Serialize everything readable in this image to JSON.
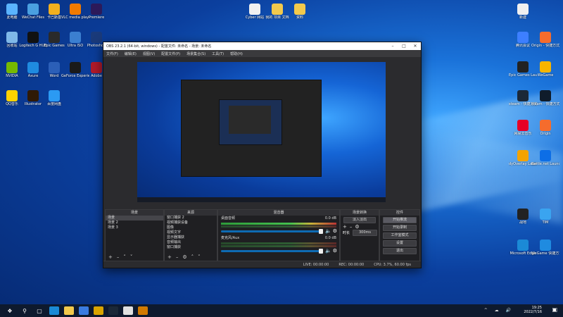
{
  "desktop": {
    "left_icons": [
      {
        "label": "此电脑",
        "color": "#5ab3ff"
      },
      {
        "label": "WeChat Files",
        "color": "#4aa0e0"
      },
      {
        "label": "卡巴斯基",
        "color": "#f2b01e"
      },
      {
        "label": "VLC media player",
        "color": "#f07a00"
      },
      {
        "label": "Premiere",
        "color": "#2c1a5a"
      },
      {
        "label": "回收站",
        "color": "#7fb8e8"
      },
      {
        "label": "Logitech G HUB",
        "color": "#111111"
      },
      {
        "label": "Epic Games",
        "color": "#2a2a2a"
      },
      {
        "label": "Ultra ISO",
        "color": "#3b7fd0"
      },
      {
        "label": "Photoshop",
        "color": "#1a3a7a"
      },
      {
        "label": "NVIDIA",
        "color": "#76b900"
      },
      {
        "label": "Axure",
        "color": "#1f8be0"
      },
      {
        "label": "Word",
        "color": "#2b5fb8"
      },
      {
        "label": "GeForce Experience",
        "color": "#1a1a1a"
      },
      {
        "label": "Adobe",
        "color": "#b01a2a"
      },
      {
        "label": "QQ音乐",
        "color": "#ffd200"
      },
      {
        "label": "Illustrator",
        "color": "#2f1a06"
      },
      {
        "label": "百度网盘",
        "color": "#2b9af3"
      }
    ],
    "right_icons": [
      {
        "label": "腾讯会议",
        "color": "#3d7fff"
      },
      {
        "label": "Origin - 快捷方式",
        "color": "#f56c2d"
      },
      {
        "label": "Epic Games Launcher",
        "color": "#222222"
      },
      {
        "label": "WeGame",
        "color": "#f7b500"
      },
      {
        "label": "steam - 快捷方式",
        "color": "#1b2838"
      },
      {
        "label": "steam - 快捷方式",
        "color": "#0f1c2b"
      },
      {
        "label": "网易云音乐",
        "color": "#e60026"
      },
      {
        "label": "Origin",
        "color": "#f56c2d"
      },
      {
        "label": "dyOverlay Launcher",
        "color": "#f4a300"
      },
      {
        "label": "Battle.net Launcher",
        "color": "#0d6ee6"
      },
      {
        "label": "战地",
        "color": "#222222"
      },
      {
        "label": "TIM",
        "color": "#3aa4f0"
      },
      {
        "label": "Microsoft Edge",
        "color": "#1b8ad6"
      },
      {
        "label": "WeGame 快捷方式",
        "color": "#1f8be0"
      }
    ],
    "top_icons": [
      {
        "label": "Cyber 网站",
        "color": "#f0f0f0"
      },
      {
        "label": "我的 项目 文档",
        "color": "#f2c94c"
      },
      {
        "label": "资料",
        "color": "#f2c94c"
      },
      {
        "label": "新建",
        "color": "#f0f0f0"
      }
    ]
  },
  "obs": {
    "title": "OBS 23.2.1 (64-bit, windows) - 配置文件: 未命名 - 场景: 未命名",
    "menu": [
      "文件(F)",
      "编辑(E)",
      "视图(V)",
      "配置文件(P)",
      "场景集合(S)",
      "工具(T)",
      "帮助(H)"
    ],
    "docks": {
      "scenes": {
        "title": "场景",
        "items": [
          "场景",
          "场景 2",
          "场景 3"
        ]
      },
      "sources": {
        "title": "来源",
        "items": [
          "窗口捕获 2",
          "视频捕获设备",
          "图像",
          "视频文字",
          "显示器捕获",
          "音频输出",
          "窗口捕获"
        ]
      },
      "mixer": {
        "title": "混音器",
        "channels": [
          {
            "name": "桌面音频",
            "db": "0.0 dB"
          },
          {
            "name": "麦克风/Aux",
            "db": "0.0 dB"
          }
        ]
      },
      "transitions": {
        "title": "场景转换",
        "type": "淡入淡出",
        "duration_label": "时长",
        "duration_value": "300ms"
      },
      "controls": {
        "title": "控件",
        "buttons": [
          "开始推流",
          "开始录制",
          "工作室模式",
          "设置",
          "退出"
        ]
      }
    },
    "status": {
      "live": "LIVE: 00:00:00",
      "rec": "REC: 00:00:00",
      "cpu": "CPU: 3.7%, 60.00 fps"
    }
  },
  "taskbar": {
    "time": "19:25",
    "date": "2022/7/16",
    "tray_label": "中 英"
  }
}
